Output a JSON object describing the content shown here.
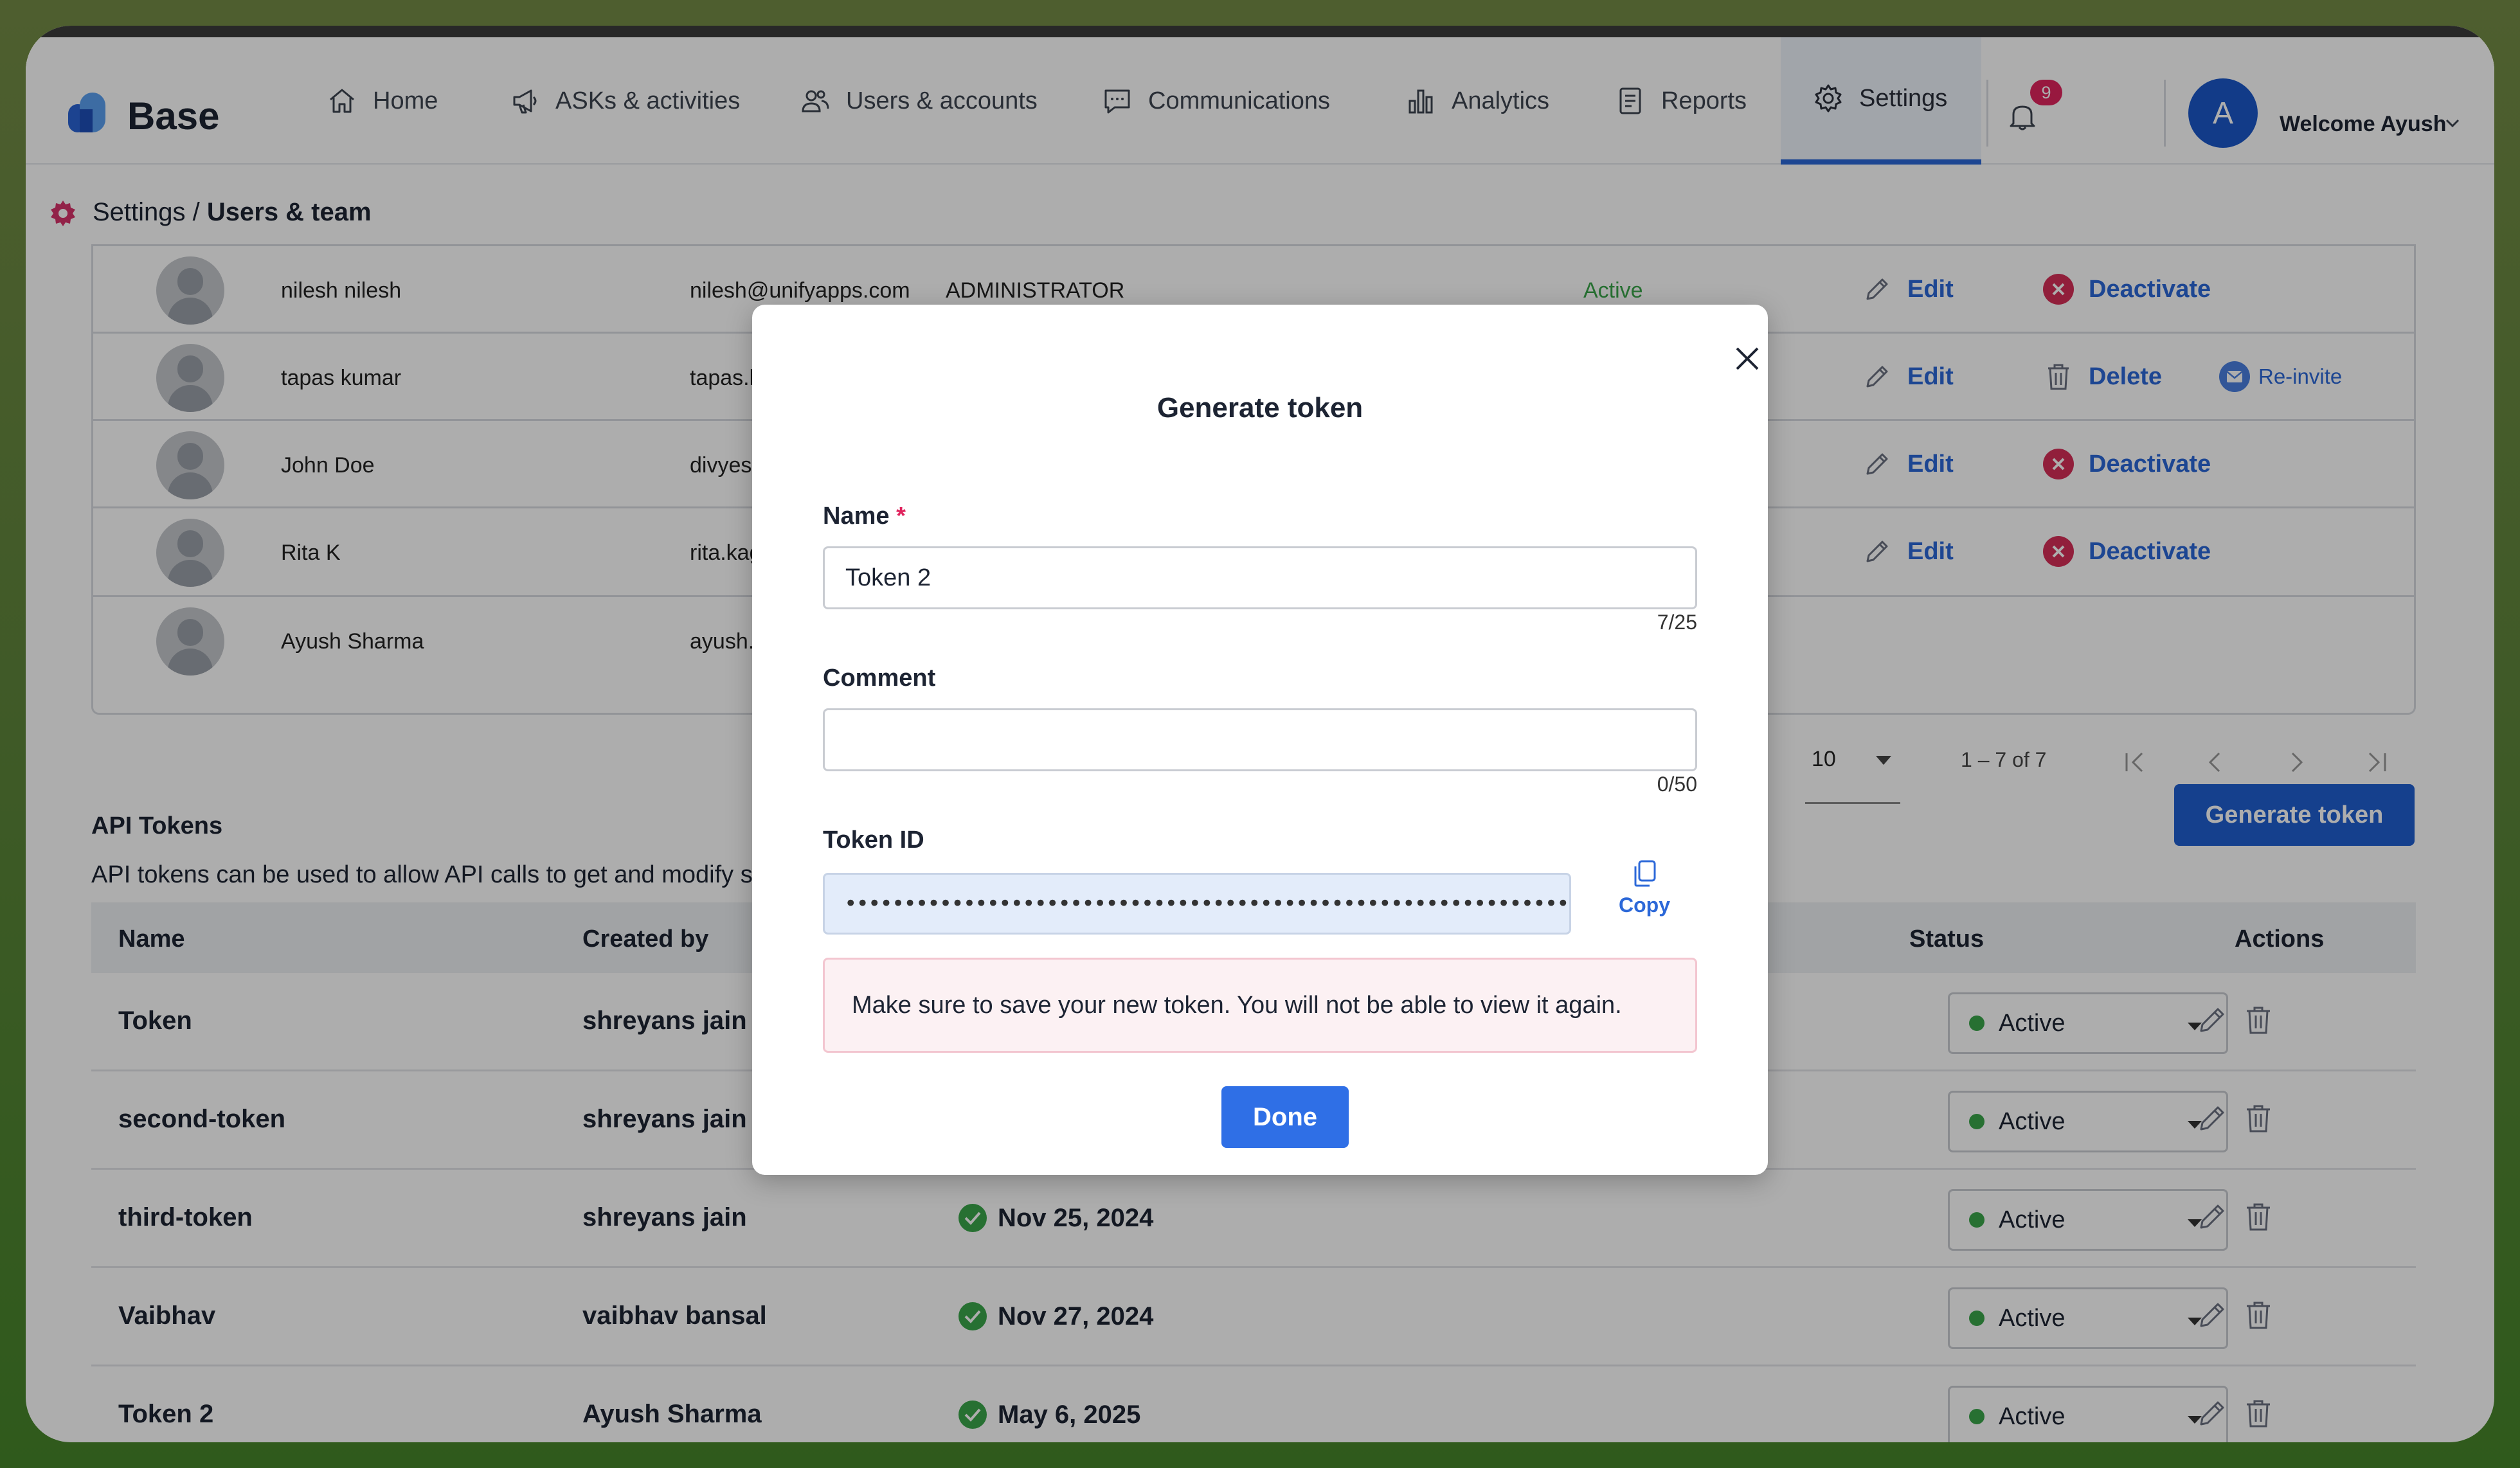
{
  "app": {
    "name": "Base"
  },
  "nav": {
    "items": [
      {
        "label": "Home",
        "icon": "home-icon"
      },
      {
        "label": "ASKs & activities",
        "icon": "megaphone-icon"
      },
      {
        "label": "Users & accounts",
        "icon": "users-icon"
      },
      {
        "label": "Communications",
        "icon": "chat-icon"
      },
      {
        "label": "Analytics",
        "icon": "bar-chart-icon"
      },
      {
        "label": "Reports",
        "icon": "report-icon"
      },
      {
        "label": "Settings",
        "icon": "gear-icon",
        "active": true
      }
    ],
    "notifications_count": "9",
    "avatar_initial": "A",
    "welcome": "Welcome Ayush"
  },
  "breadcrumb": {
    "root": "Settings",
    "separator": " / ",
    "current": "Users & team"
  },
  "users": {
    "rows": [
      {
        "name": "nilesh nilesh",
        "email": "nilesh@unifyapps.com",
        "role": "ADMINISTRATOR",
        "status": "Active",
        "actions": [
          "Edit",
          "Deactivate"
        ]
      },
      {
        "name": "tapas kumar",
        "email": "tapas.k",
        "role": "",
        "status": "",
        "actions": [
          "Edit",
          "Delete",
          "Re-invite"
        ]
      },
      {
        "name": "John Doe",
        "email": "divyesh",
        "role": "",
        "status": "",
        "actions": [
          "Edit",
          "Deactivate"
        ]
      },
      {
        "name": "Rita K",
        "email": "rita.kag",
        "role": "",
        "status": "",
        "actions": [
          "Edit",
          "Deactivate"
        ]
      },
      {
        "name": "Ayush Sharma",
        "email": "ayush.s",
        "role": "",
        "status": "",
        "actions": []
      }
    ],
    "pagination": {
      "page_size": "10",
      "range": "1 – 7 of 7"
    }
  },
  "api_tokens": {
    "title": "API Tokens",
    "description": "API tokens can be used to allow API calls to get and modify s",
    "generate_label": "Generate token",
    "columns": [
      "Name",
      "Created by",
      "Status",
      "Actions"
    ],
    "rows": [
      {
        "name": "Token",
        "created_by": "shreyans jain",
        "date": "",
        "status": "Active"
      },
      {
        "name": "second-token",
        "created_by": "shreyans jain",
        "date": "",
        "status": "Active"
      },
      {
        "name": "third-token",
        "created_by": "shreyans jain",
        "date": "Nov 25, 2024",
        "status": "Active"
      },
      {
        "name": "Vaibhav",
        "created_by": "vaibhav bansal",
        "date": "Nov 27, 2024",
        "status": "Active"
      },
      {
        "name": "Token 2",
        "created_by": "Ayush Sharma",
        "date": "May 6, 2025",
        "status": "Active"
      }
    ]
  },
  "modal": {
    "title": "Generate token",
    "name_label": "Name",
    "required_mark": "*",
    "name_value": "Token 2",
    "name_count": "7/25",
    "comment_label": "Comment",
    "comment_value": "",
    "comment_count": "0/50",
    "token_label": "Token ID",
    "token_masked": "••••••••••••••••••••••••••••••••••••••••••••••••••••••••••••••••••••••",
    "copy_label": "Copy",
    "warning": "Make sure to save your new token. You will not be able to view it again.",
    "done_label": "Done"
  },
  "colors": {
    "accent": "#2c68d8",
    "primary_button": "#1f5fd0",
    "danger": "#e0245e",
    "success": "#3aa54a"
  }
}
